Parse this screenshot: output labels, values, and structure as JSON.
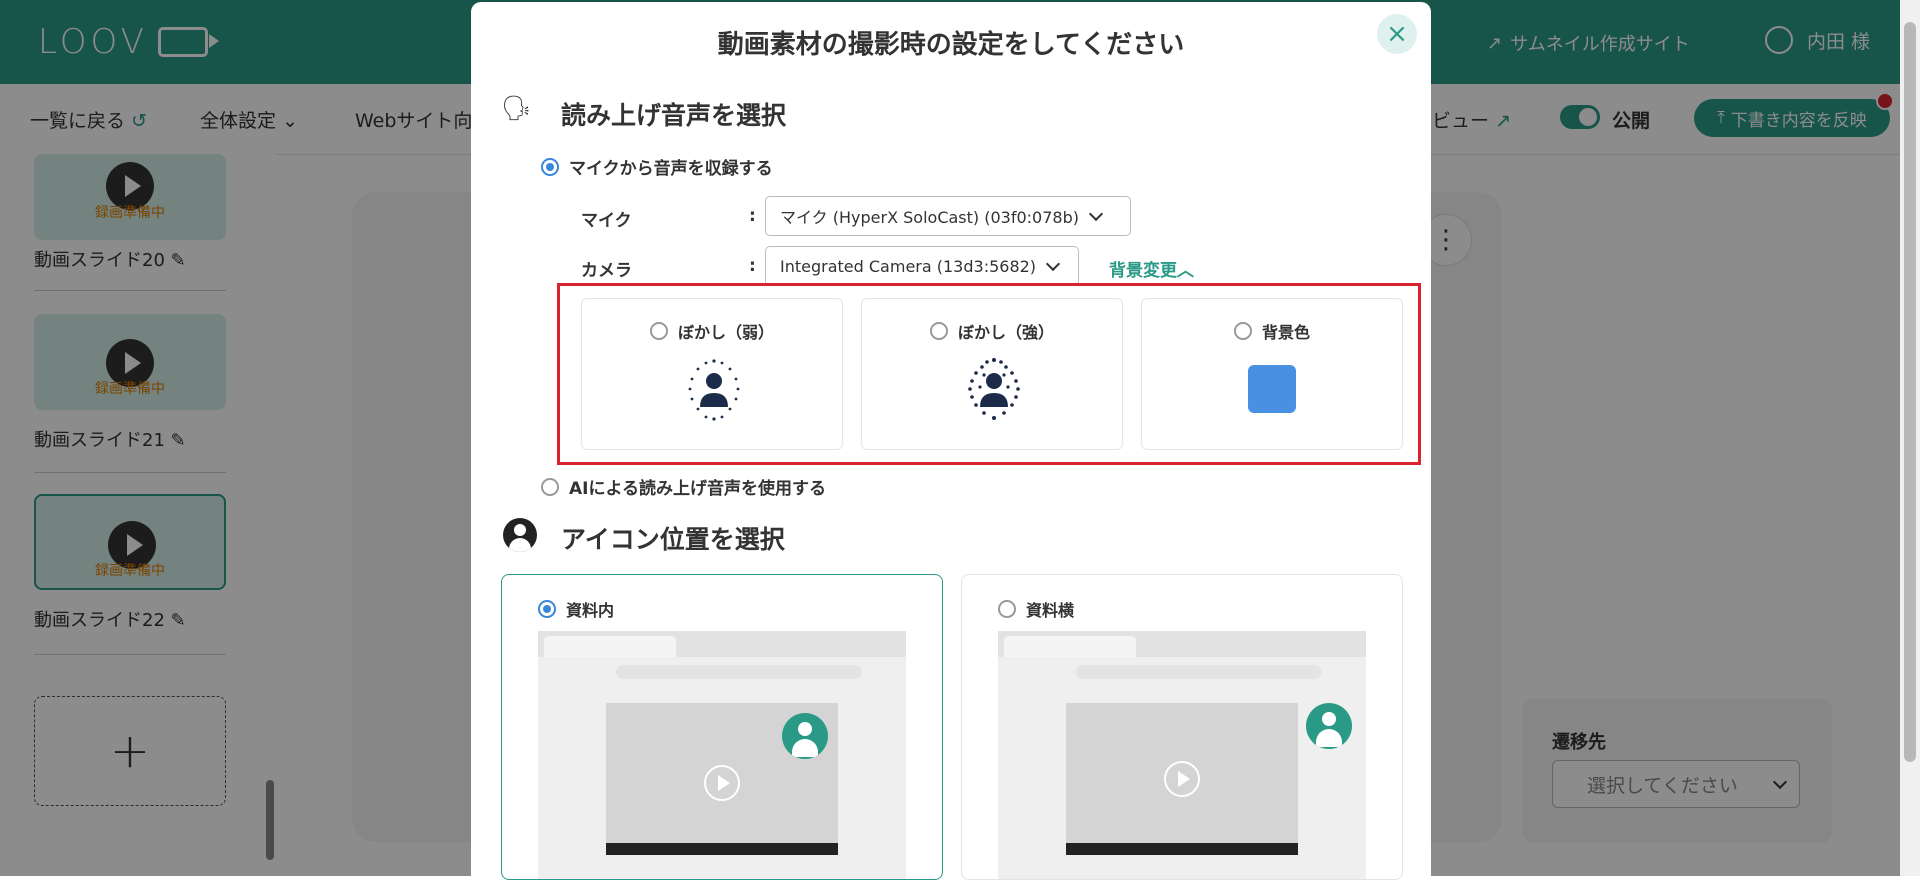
{
  "header": {
    "logo": "LOOV",
    "thumbnail_site": "サムネイル作成サイト",
    "user_name": "内田 様"
  },
  "toolbar": {
    "back": "一覧に戻る",
    "all_settings": "全体設定",
    "website": "Webサイト向",
    "preview": "ビュー",
    "publish": "公開",
    "reflect": "下書き内容を反映"
  },
  "slides": [
    {
      "label": "動画スライド20",
      "status": "録画準備中"
    },
    {
      "label": "動画スライド21",
      "status": "録画準備中"
    },
    {
      "label": "動画スライド22",
      "status": "録画準備中"
    }
  ],
  "add_slide": "+",
  "destination": {
    "label": "遷移先",
    "placeholder": "選択してください"
  },
  "modal": {
    "title": "動画素材の撮影時の設定をしてください",
    "close": "×",
    "voice_section": {
      "title": "読み上げ音声を選択",
      "option_mic": "マイクから音声を収録する",
      "mic_label": "マイク",
      "mic_value": "マイク (HyperX SoloCast) (03f0:078b)",
      "camera_label": "カメラ",
      "camera_value": "Integrated Camera (13d3:5682)",
      "colon": ":",
      "bg_change": "背景変更",
      "bg_options": [
        "ぼかし（弱）",
        "ぼかし（強）",
        "背景色"
      ],
      "bg_color": "#4a90e2",
      "option_ai": "AIによる読み上げ音声を使用する"
    },
    "icon_section": {
      "title": "アイコン位置を選択",
      "options": [
        "資料内",
        "資料横"
      ]
    }
  },
  "colors": {
    "brand": "#2a9a86",
    "highlight": "#d9242f",
    "radio_on": "#3a86d9"
  }
}
